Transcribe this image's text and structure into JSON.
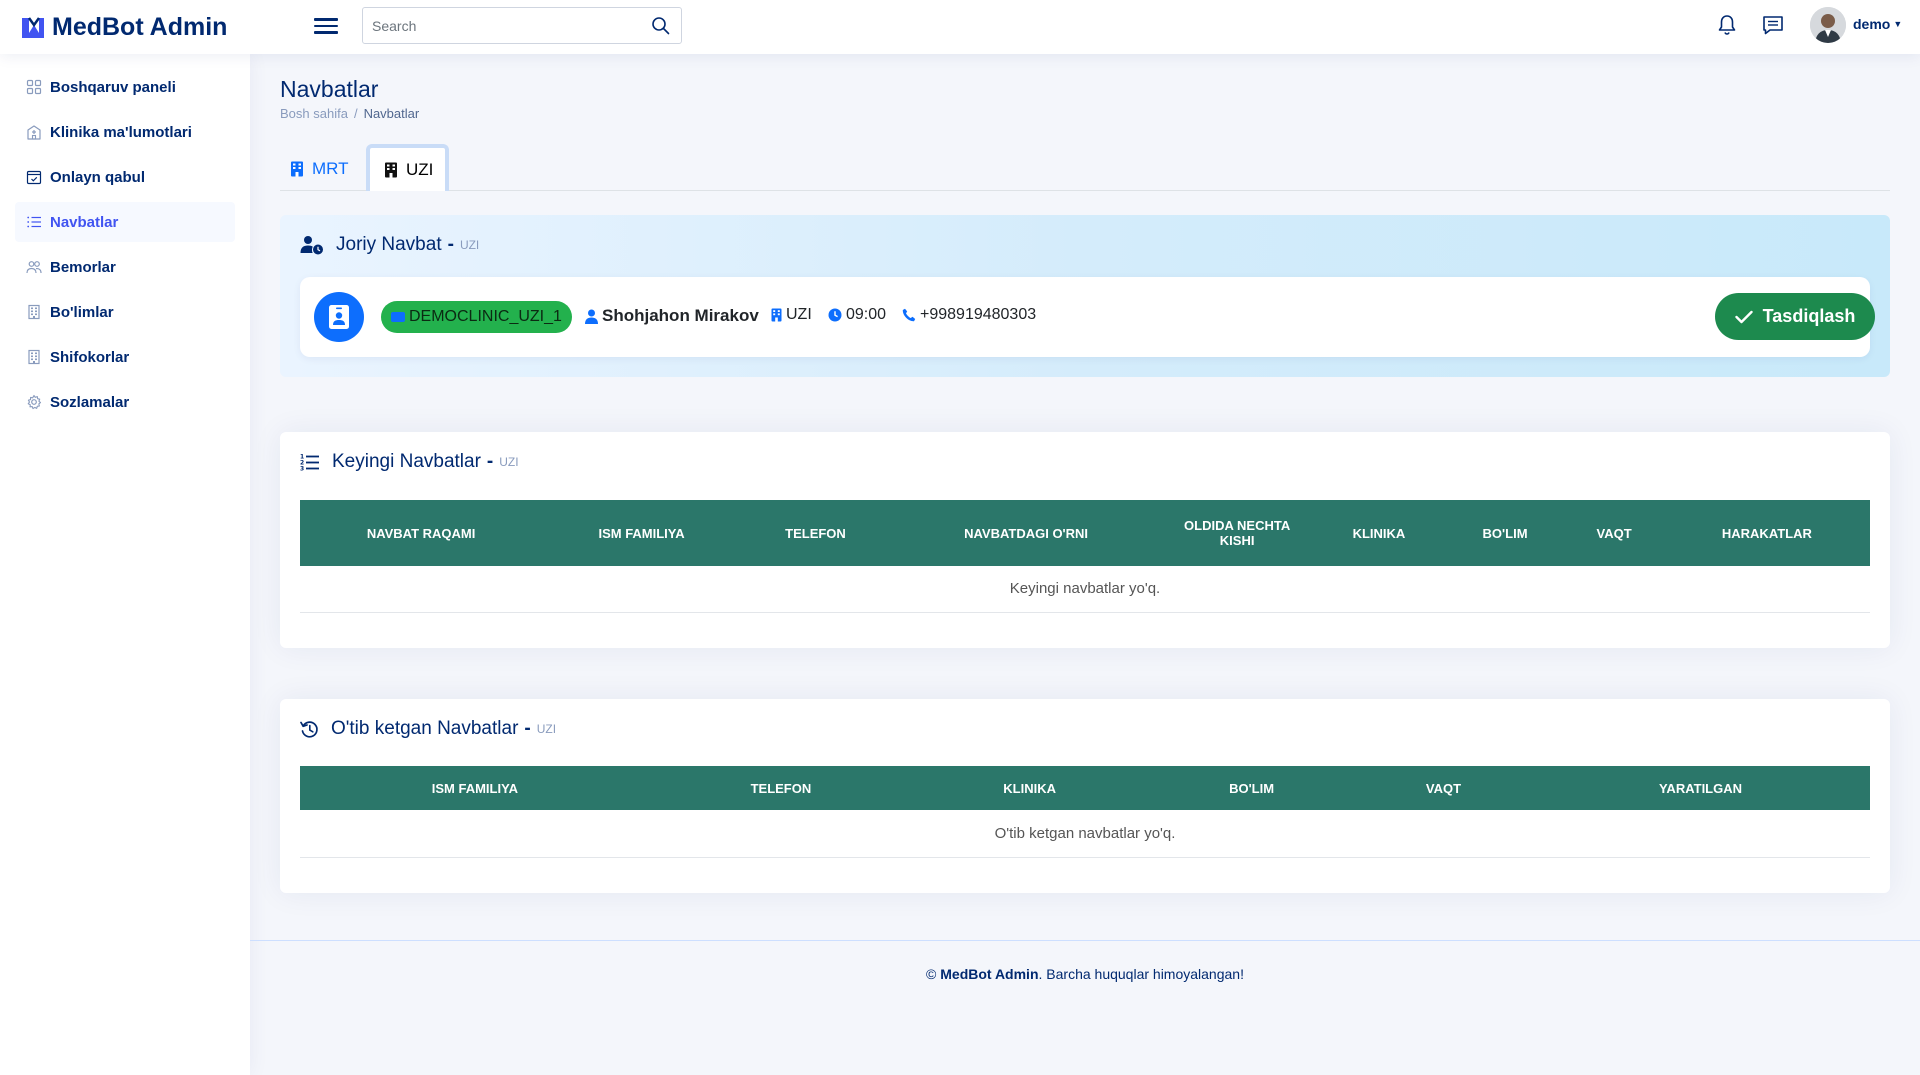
{
  "app": {
    "name": "MedBot Admin"
  },
  "header": {
    "search_placeholder": "Search",
    "user": "demo"
  },
  "sidebar": {
    "items": [
      {
        "label": "Boshqaruv paneli",
        "icon": "grid-icon",
        "active": false
      },
      {
        "label": "Klinika ma'lumotlari",
        "icon": "hospital-icon",
        "active": false
      },
      {
        "label": "Onlayn qabul",
        "icon": "calendar-check-icon",
        "active": false
      },
      {
        "label": "Navbatlar",
        "icon": "list-ol-icon",
        "active": true
      },
      {
        "label": "Bemorlar",
        "icon": "people-icon",
        "active": false
      },
      {
        "label": "Bo'limlar",
        "icon": "building-icon",
        "active": false
      },
      {
        "label": "Shifokorlar",
        "icon": "building-icon",
        "active": false
      },
      {
        "label": "Sozlamalar",
        "icon": "gear-icon",
        "active": false
      }
    ]
  },
  "page": {
    "title": "Navbatlar",
    "breadcrumb": {
      "home": "Bosh sahifa",
      "current": "Navbatlar"
    }
  },
  "tabs": [
    {
      "label": "MRT",
      "active": false
    },
    {
      "label": "UZI",
      "active": true
    }
  ],
  "current_queue": {
    "title": "Joriy Navbat",
    "dash": "-",
    "subtitle": "UZI",
    "code": "DEMOCLINIC_UZI_1",
    "patient": "Shohjahon Mirakov",
    "department": "UZI",
    "time": "09:00",
    "phone": "+998919480303",
    "confirm_label": "Tasdiqlash"
  },
  "next_queue": {
    "title": "Keyingi Navbatlar",
    "dash": "-",
    "subtitle": "UZI",
    "columns": [
      "Navbat raqami",
      "Ism familiya",
      "Telefon",
      "Navbatdagi o'rni",
      "Oldida nechta kishi",
      "Klinika",
      "Bo'lim",
      "Vaqt",
      "Harakatlar"
    ],
    "empty_text": "Keyingi navbatlar yo'q."
  },
  "past_queue": {
    "title": "O'tib ketgan Navbatlar",
    "dash": "-",
    "subtitle": "UZI",
    "columns": [
      "Ism familiya",
      "Telefon",
      "Klinika",
      "Bo'lim",
      "Vaqt",
      "Yaratilgan"
    ],
    "empty_text": "O'tib ketgan navbatlar yo'q."
  },
  "footer": {
    "copyright": "©",
    "brand": "MedBot Admin",
    "text": ". Barcha huquqlar himoyalangan!"
  },
  "colors": {
    "primary": "#012970",
    "accent": "#4154f1",
    "table_header": "#2b776a",
    "confirm": "#1d8a4e",
    "badge": "#23b14d"
  }
}
